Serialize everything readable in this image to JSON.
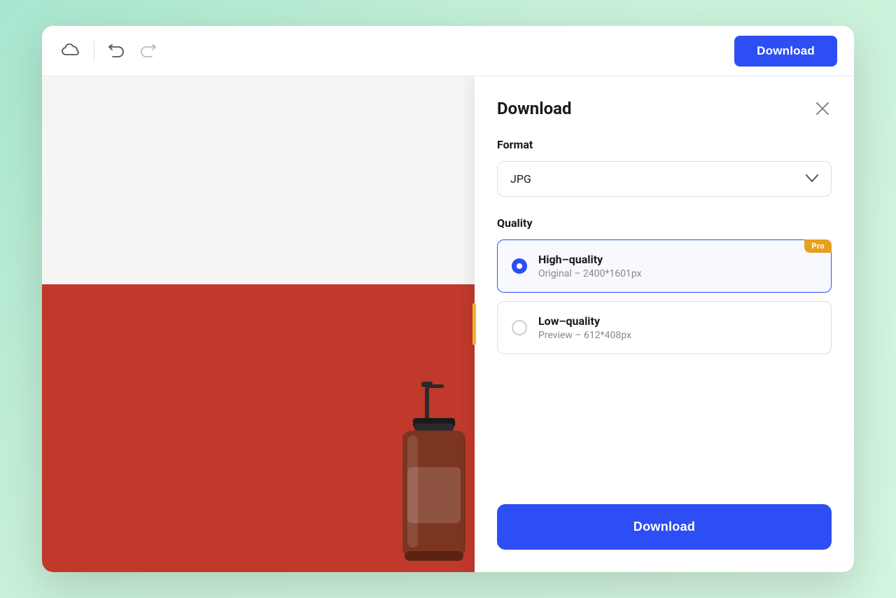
{
  "toolbar": {
    "cloud_icon": "☁",
    "undo_label": "↩",
    "redo_label": "↪",
    "download_button_label": "Download"
  },
  "panel": {
    "title": "Download",
    "close_icon": "✕",
    "format_label": "Format",
    "format_value": "JPG",
    "chevron_icon": "⌄",
    "quality_label": "Quality",
    "options": [
      {
        "id": "high",
        "title": "High–quality",
        "subtitle": "Original – 2400*1601px",
        "selected": true,
        "pro": true,
        "pro_label": "Pro"
      },
      {
        "id": "low",
        "title": "Low–quality",
        "subtitle": "Preview – 612*408px",
        "selected": false,
        "pro": false
      }
    ],
    "download_button_label": "Download"
  },
  "canvas": {
    "background_top": "#f5f5f5",
    "background_bottom": "#c0392b"
  }
}
